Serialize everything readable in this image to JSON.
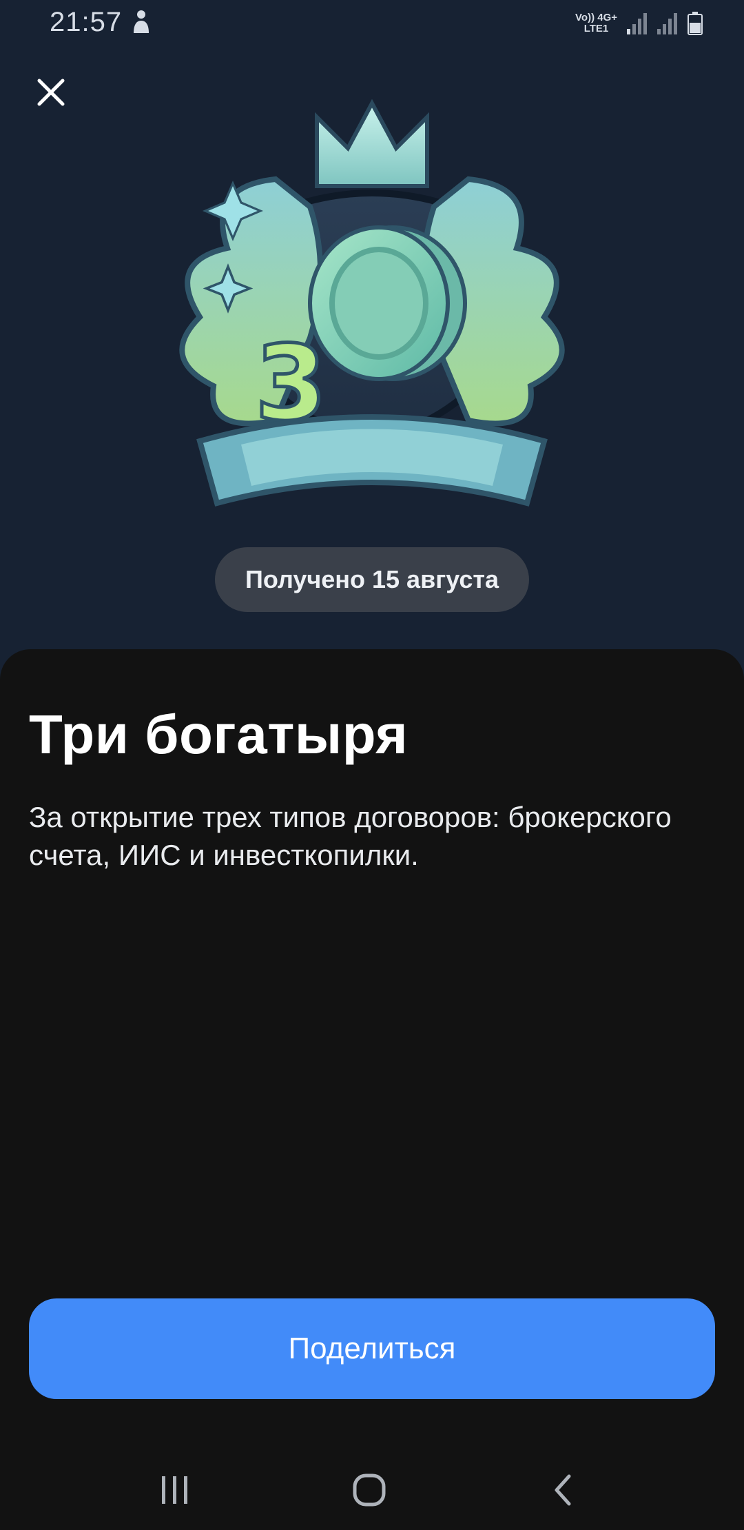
{
  "status_bar": {
    "time": "21:57",
    "network_top": "Vo)) 4G+",
    "network_bottom": "LTE1",
    "icons": [
      "person-icon",
      "signal-icon",
      "signal-icon",
      "battery-icon"
    ]
  },
  "header": {
    "close_icon": "close-icon"
  },
  "badge": {
    "image": "three-heroes-award-badge",
    "received_label": "Получено 15 августа"
  },
  "achievement": {
    "title": "Три богатыря",
    "description": "За открытие трех типов договоров: брокерского счета, ИИС и инвесткопилки."
  },
  "actions": {
    "share_label": "Поделиться"
  },
  "nav_bar": {
    "icons": [
      "recent-apps-icon",
      "home-icon",
      "back-icon"
    ]
  },
  "colors": {
    "hero_bg": "#172233",
    "sheet_bg": "#121212",
    "pill_bg": "#3a404a",
    "accent": "#428bf9"
  }
}
